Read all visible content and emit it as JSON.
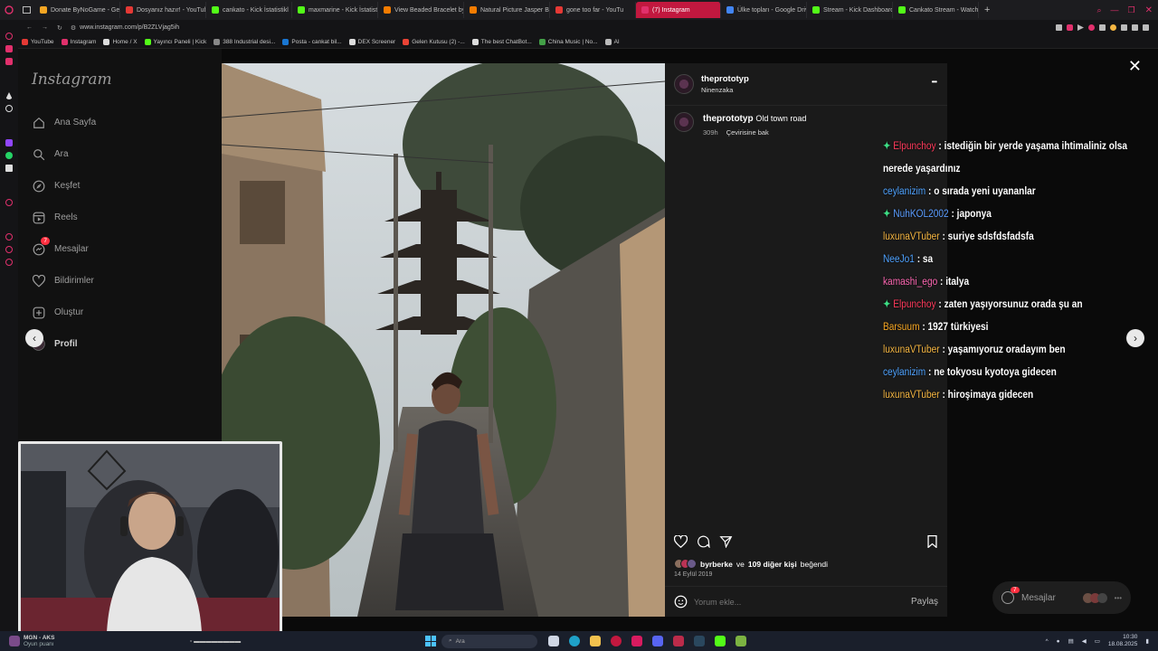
{
  "browser": {
    "tabs": [
      {
        "label": "Donate ByNoGame - Ge",
        "color": "#f5a623"
      },
      {
        "label": "Dosyanız hazır! - YouTub",
        "color": "#e53935"
      },
      {
        "label": "cankato - Kick İstatistikl",
        "color": "#53fc18"
      },
      {
        "label": "maxmarine - Kick İstatist",
        "color": "#53fc18"
      },
      {
        "label": "View Beaded Bracelet by",
        "color": "#f57c00"
      },
      {
        "label": "Natural Picture Jasper Bl",
        "color": "#f57c00"
      },
      {
        "label": "gone too far - YouTu",
        "color": "#e53935"
      },
      {
        "label": "(7) Instagram",
        "color": "#e1306c"
      },
      {
        "label": "Ülke topları - Google Driv",
        "color": "#4285f4"
      },
      {
        "label": "Stream - Kick Dashboard",
        "color": "#53fc18"
      },
      {
        "label": "Cankato Stream - Watch",
        "color": "#53fc18"
      }
    ],
    "active_tab_index": 7,
    "url": "www.instagram.com/p/B2ZLVjag5ih",
    "bookmarks": [
      {
        "label": "YouTube",
        "color": "#e53935"
      },
      {
        "label": "Instagram",
        "color": "#e1306c"
      },
      {
        "label": "Home / X",
        "color": "#dddddd"
      },
      {
        "label": "Yayıncı Paneli | Kick",
        "color": "#53fc18"
      },
      {
        "label": "388 Industrial desi...",
        "color": "#888888"
      },
      {
        "label": "Posta - cankat bil...",
        "color": "#1976d2"
      },
      {
        "label": "DEX Screener",
        "color": "#dddddd"
      },
      {
        "label": "Gelen Kutusu (2) -...",
        "color": "#ea4335"
      },
      {
        "label": "The best ChatBot...",
        "color": "#dddddd"
      },
      {
        "label": "China Music | No...",
        "color": "#43a047"
      },
      {
        "label": "AI",
        "color": "#bbbbbb"
      }
    ]
  },
  "ig_sidebar": {
    "logo": "Instagram",
    "items": [
      {
        "label": "Ana Sayfa",
        "icon": "home-icon"
      },
      {
        "label": "Ara",
        "icon": "search-icon"
      },
      {
        "label": "Keşfet",
        "icon": "compass-icon"
      },
      {
        "label": "Reels",
        "icon": "reels-icon"
      },
      {
        "label": "Mesajlar",
        "icon": "messenger-icon",
        "badge": "7"
      },
      {
        "label": "Bildirimler",
        "icon": "heart-icon"
      },
      {
        "label": "Oluştur",
        "icon": "plus-square-icon"
      },
      {
        "label": "Profil",
        "icon": "avatar-icon"
      }
    ]
  },
  "post": {
    "username": "theprototyp",
    "location": "Ninenzaka",
    "caption_user": "theprototyp",
    "caption_text": "Old town road",
    "caption_age": "309h",
    "translate_label": "Çevirisine bak",
    "likes_user": "byrberke",
    "likes_mid": "ve",
    "likes_rest": "109 diğer kişi",
    "likes_suffix": "beğendi",
    "date": "14 Eylül 2019",
    "comment_placeholder": "Yorum ekle...",
    "share_label": "Paylaş",
    "more_label": "•••"
  },
  "messages_pill": {
    "label": "Mesajlar",
    "badge": "7"
  },
  "chat": [
    {
      "user": "Elpunchoy",
      "color": "#ff3b5c",
      "badge": true,
      "text": "istediğin bir yerde yaşama ihtimaliniz olsa nerede yaşardınız"
    },
    {
      "user": "ceylanizim",
      "color": "#4fa3ff",
      "badge": false,
      "text": "o sırada yeni uyananlar"
    },
    {
      "user": "NuhKOL2002",
      "color": "#5b9dff",
      "badge": true,
      "text": "japonya"
    },
    {
      "user": "luxunaVTuber",
      "color": "#f5b642",
      "badge": false,
      "text": "suriye sdsfdsfadsfa"
    },
    {
      "user": "NeeJo1",
      "color": "#4fa3ff",
      "badge": false,
      "text": "sa"
    },
    {
      "user": "kamashi_ego",
      "color": "#ff69b4",
      "badge": false,
      "text": "italya"
    },
    {
      "user": "Elpunchoy",
      "color": "#ff3b5c",
      "badge": true,
      "text": "zaten yaşıyorsunuz orada şu an"
    },
    {
      "user": "Barsuum",
      "color": "#f5a623",
      "badge": false,
      "text": "1927 türkiyesi"
    },
    {
      "user": "luxunaVTuber",
      "color": "#f5b642",
      "badge": false,
      "text": "yaşamıyoruz oradayım ben"
    },
    {
      "user": "ceylanizim",
      "color": "#4fa3ff",
      "badge": false,
      "text": "ne tokyosu kyotoya gidecen"
    },
    {
      "user": "luxunaVTuber",
      "color": "#f5b642",
      "badge": false,
      "text": "hiroşimaya gidecen"
    }
  ],
  "taskbar": {
    "media_title": "MGN - AKS",
    "media_sub": "Oyun puanı",
    "search_placeholder": "Ara",
    "time": "10:30",
    "date": "18.08.2025"
  }
}
